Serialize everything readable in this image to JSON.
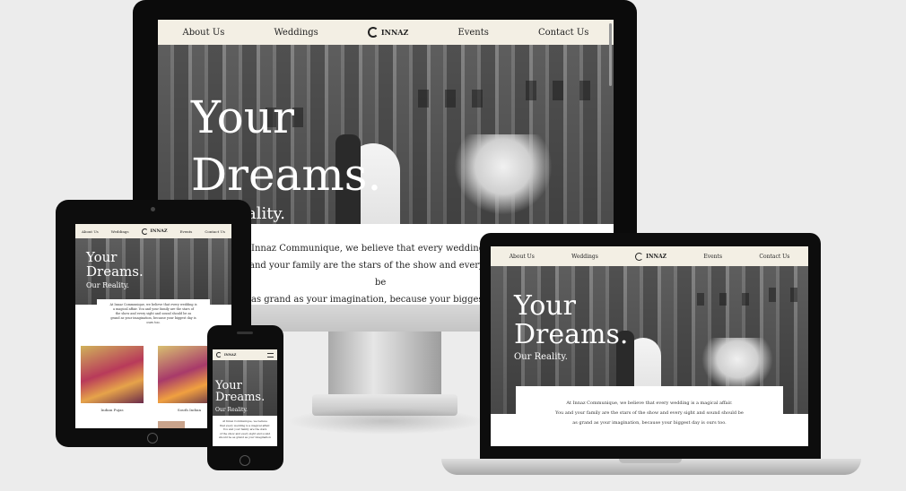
{
  "nav": {
    "about": "About Us",
    "weddings": "Weddings",
    "brand": "INNAZ",
    "events": "Events",
    "contact": "Contact Us"
  },
  "hero": {
    "line1": "Your",
    "line2": "Dreams.",
    "line3": "Our Reality."
  },
  "desktop": {
    "partial_tagline": "ality.",
    "intro_l1": "Innaz Communique, we believe that every wedding is a m",
    "intro_l2": "and your family are the stars of the show and every sight ar",
    "intro_l3": "be",
    "intro_l4": "as grand as your imagination, because your biggest day is"
  },
  "laptop": {
    "intro_l1": "At Innaz Communique, we believe that every wedding is a magical affair.",
    "intro_l2": "You and your family are the stars of the show and every sight and sound should be",
    "intro_l3": "as grand as your imagination, because your biggest day is ours too."
  },
  "tablet": {
    "intro_l1": "At Innaz Communique, we believe that every wedding is",
    "intro_l2": "a magical affair. You and your family are the stars of",
    "intro_l3": "the show and every sight and sound should be as",
    "intro_l4": "grand as your imagination, because your biggest day is",
    "intro_l5": "ours too.",
    "card1": "Indian Pujas",
    "card2": "South Indian"
  },
  "phone": {
    "intro_l1": "At Innaz Communique, we believe",
    "intro_l2": "that every wedding is a magical affair.",
    "intro_l3": "You and your family are the stars",
    "intro_l4": "of the show and every sight and sound",
    "intro_l5": "should be as grand as your imagination"
  }
}
